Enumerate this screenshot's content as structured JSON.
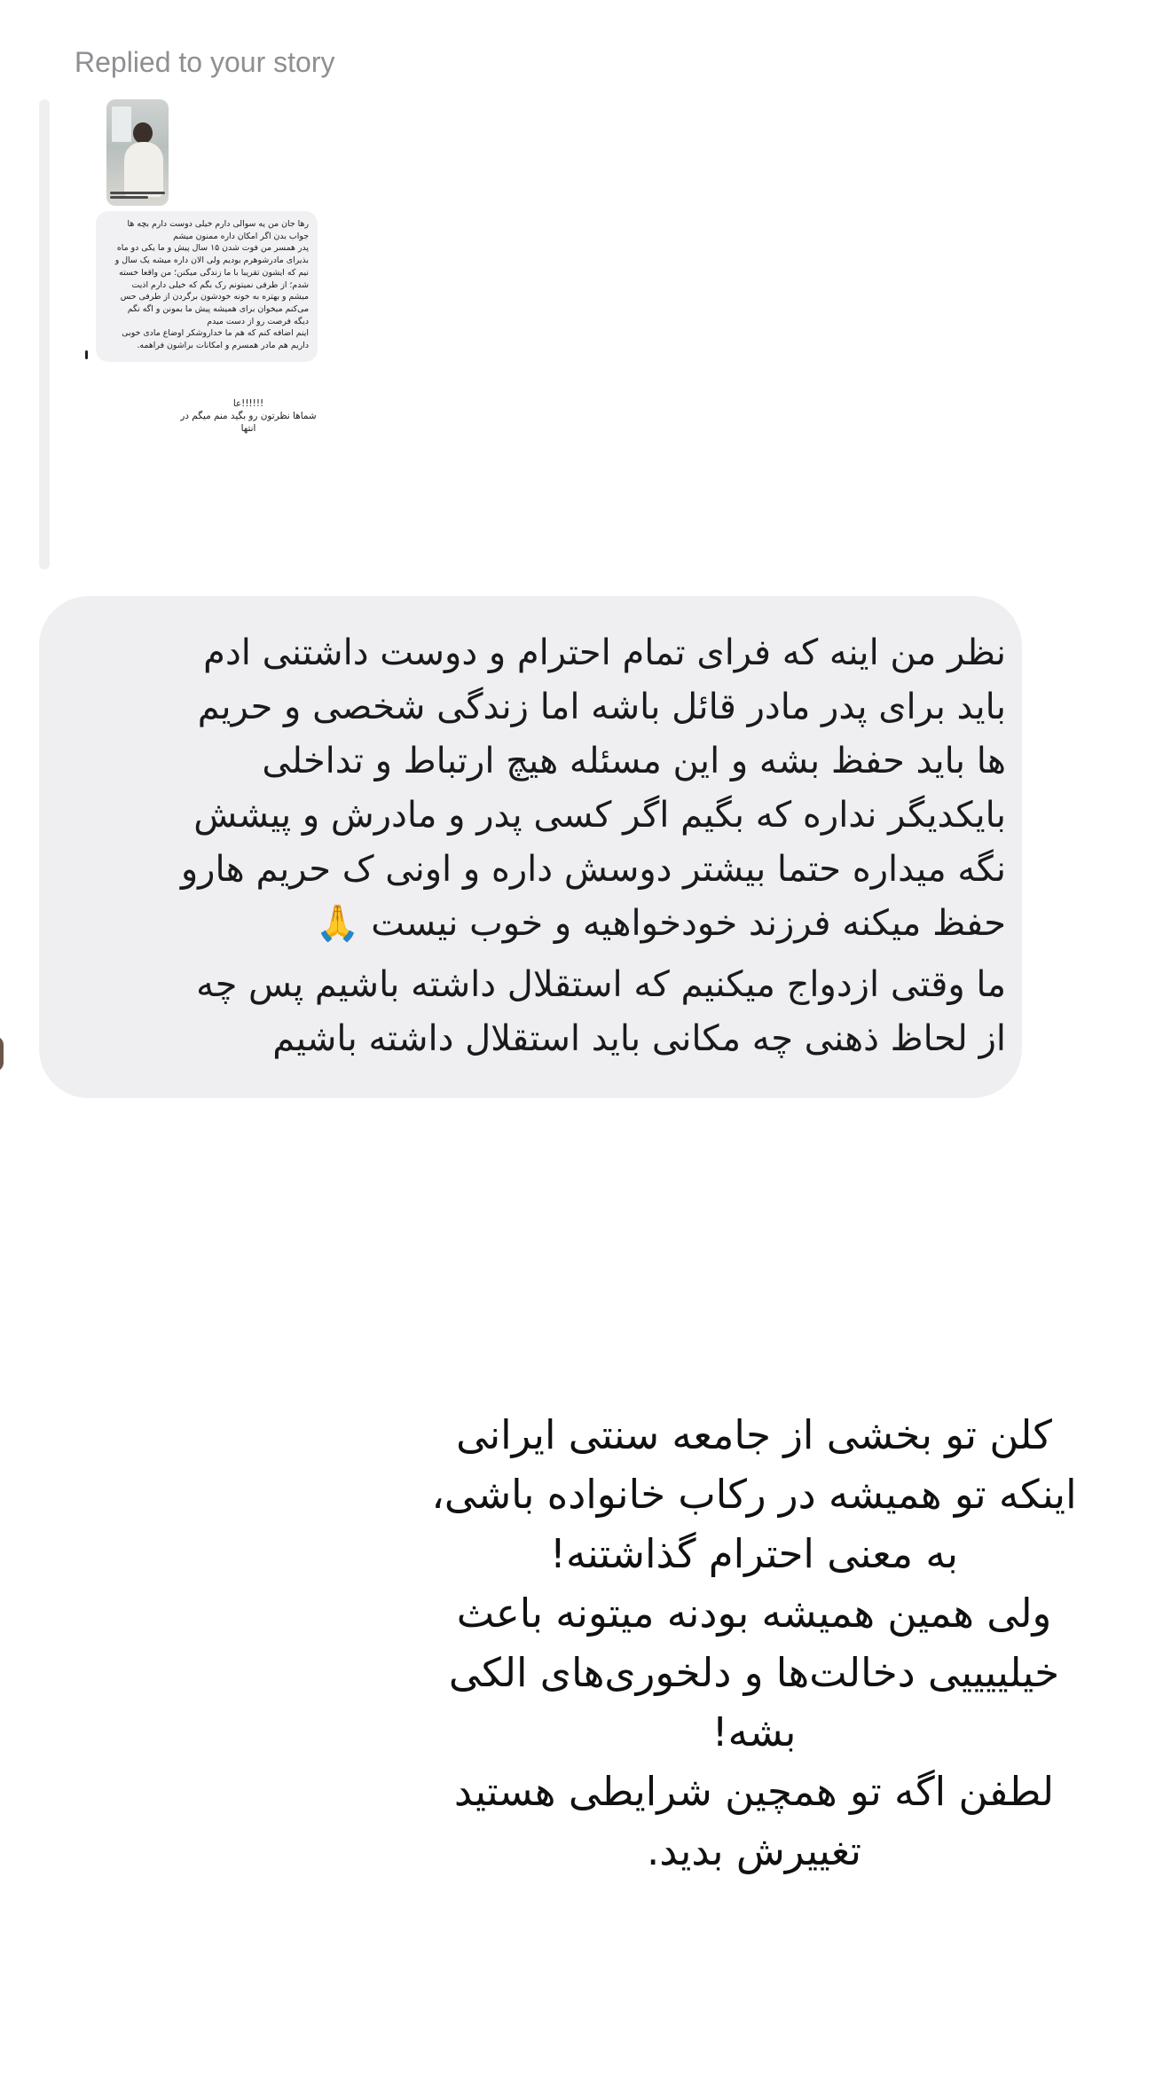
{
  "reply_header": "Replied to your story",
  "story": {
    "card_lines": [
      "رها جان من یه سوالی دارم خیلی دوست دارم بچه ها",
      "جواب بدن اگر امکان داره ممنون میشم",
      "پدر همسر من فوت شدن ۱۵ سال پیش و ما یکی دو ماه",
      "بذیرای مادرشوهرم بودیم ولی الان داره میشه یک سال و",
      "نیم که ایشون تقریبا با ما زندگی میکنن؛ من واقعا خسته",
      "شدم؛ از طرفی نمیتونم رک بگم که خیلی دارم اذیت",
      "میشم و بهتره به خونه خودشون برگردن از طرفی حس",
      "می‌کنم میخوان برای همیشه پیش ما بمونن و اگه نگم",
      "دیگه فرصت رو از دست میدم",
      "اینم اضافه کنم که هم ما خداروشکر اوضاع مادی خوبی",
      "داریم هم مادر همسرم و امکانات براشون فراهمه."
    ],
    "small_lines": [
      "!!!!!!عا",
      "شماها نظرتون رو بگید منم میگم در",
      "انتها"
    ]
  },
  "message": {
    "lines": [
      "نظر من اینه که فرای تمام احترام و دوست داشتنی ادم",
      "باید برای پدر مادر قائل باشه اما زندگی شخصی و حریم",
      "ها باید حفظ بشه و این مسئله هیچ ارتباط و تداخلی",
      "بایکدیگر نداره که بگیم اگر کسی پدر و مادرش و پیشش",
      "نگه میداره حتما بیشتر دوسش داره و اونی ک حریم هارو",
      "حفظ میکنه فرزند خودخواهیه و خوب نیست 🙏",
      "ما وقتی ازدواج میکنیم که استقلال داشته باشیم پس چه",
      "از لحاظ ذهنی چه مکانی باید استقلال داشته باشیم"
    ]
  },
  "story_overlay": {
    "lines": [
      "کلن تو بخشی از جامعه سنتی ایرانی",
      "اینکه تو همیشه در رکاب خانواده باشی،",
      "به معنی احترام گذاشتنه!",
      "ولی همین همیشه بودنه میتونه باعث",
      "خیلییییی دخالت‌ها و دلخوری‌های الکی",
      "بشه!",
      "لطفن اگه تو همچین شرایطی هستید",
      "تغییرش بدید."
    ]
  }
}
